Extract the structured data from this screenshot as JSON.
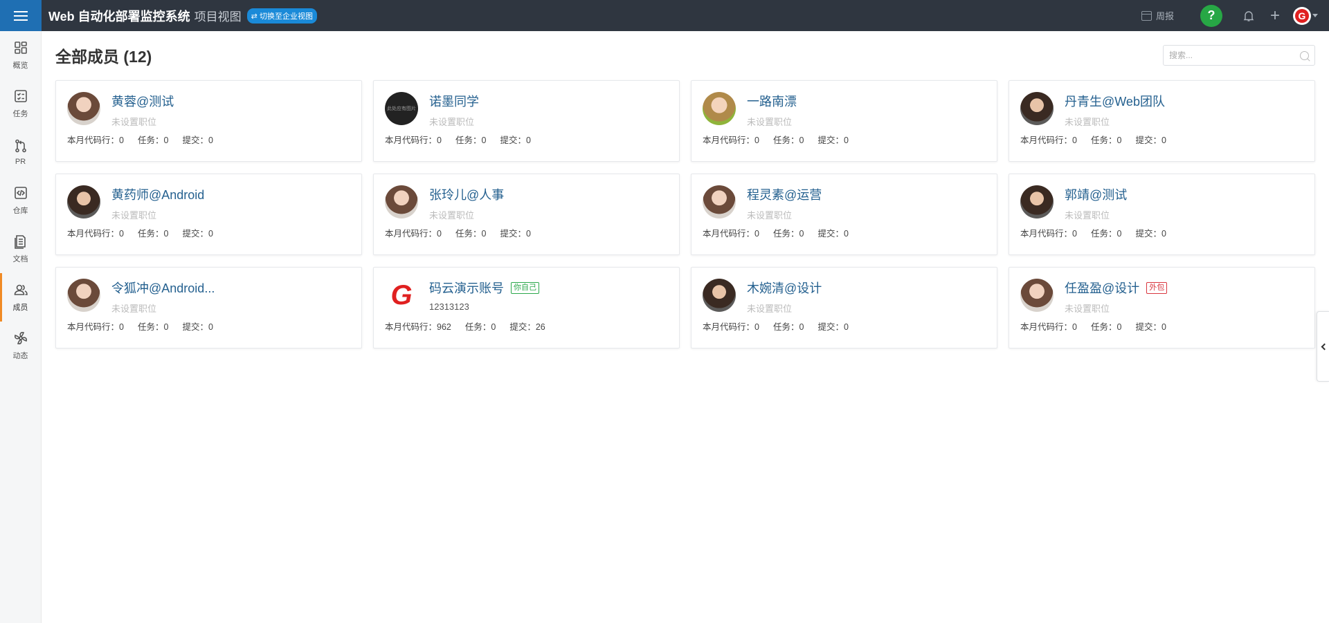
{
  "header": {
    "app_title": "Web 自动化部署监控系统",
    "view_name": "项目视图",
    "switch_label": "⇄ 切换至企业视图",
    "weekly_label": "周报",
    "help_label": "?",
    "plus_label": "+",
    "user_logo": "G"
  },
  "sidebar": {
    "items": [
      {
        "label": "概览",
        "icon": "overview-icon"
      },
      {
        "label": "任务",
        "icon": "task-icon"
      },
      {
        "label": "PR",
        "icon": "pull-request-icon"
      },
      {
        "label": "仓库",
        "icon": "repository-icon"
      },
      {
        "label": "文档",
        "icon": "document-icon"
      },
      {
        "label": "成员",
        "icon": "members-icon"
      },
      {
        "label": "动态",
        "icon": "activity-icon"
      }
    ],
    "active": "成员"
  },
  "main": {
    "title": "全部成员 (12)",
    "search_placeholder": "搜索..."
  },
  "stat_labels": {
    "lines": "本月代码行：",
    "tasks": "任务：",
    "commits": "提交："
  },
  "members": [
    {
      "name": "黄蓉@测试",
      "position": "未设置职位",
      "lines": "0",
      "tasks": "0",
      "commits": "0",
      "tag": ""
    },
    {
      "name": "诺墨同学",
      "position": "未设置职位",
      "lines": "0",
      "tasks": "0",
      "commits": "0",
      "tag": "",
      "avatar_text": "此处应有图片"
    },
    {
      "name": "一路南漂",
      "position": "未设置职位",
      "lines": "0",
      "tasks": "0",
      "commits": "0",
      "tag": ""
    },
    {
      "name": "丹青生@Web团队",
      "position": "未设置职位",
      "lines": "0",
      "tasks": "0",
      "commits": "0",
      "tag": ""
    },
    {
      "name": "黄药师@Android",
      "position": "未设置职位",
      "lines": "0",
      "tasks": "0",
      "commits": "0",
      "tag": ""
    },
    {
      "name": "张玲儿@人事",
      "position": "未设置职位",
      "lines": "0",
      "tasks": "0",
      "commits": "0",
      "tag": ""
    },
    {
      "name": "程灵素@运营",
      "position": "未设置职位",
      "lines": "0",
      "tasks": "0",
      "commits": "0",
      "tag": ""
    },
    {
      "name": "郭靖@测试",
      "position": "未设置职位",
      "lines": "0",
      "tasks": "0",
      "commits": "0",
      "tag": ""
    },
    {
      "name": "令狐冲@Android...",
      "position": "未设置职位",
      "lines": "0",
      "tasks": "0",
      "commits": "0",
      "tag": ""
    },
    {
      "name": "码云演示账号",
      "position": "12313123",
      "lines": "962",
      "tasks": "0",
      "commits": "26",
      "tag": "你自己",
      "avatar_text": "G"
    },
    {
      "name": "木婉清@设计",
      "position": "未设置职位",
      "lines": "0",
      "tasks": "0",
      "commits": "0",
      "tag": ""
    },
    {
      "name": "任盈盈@设计",
      "position": "未设置职位",
      "lines": "0",
      "tasks": "0",
      "commits": "0",
      "tag": "外包"
    }
  ],
  "colors": {
    "accent": "#f08a24",
    "topbar": "#2f3640",
    "link": "#24608f"
  }
}
